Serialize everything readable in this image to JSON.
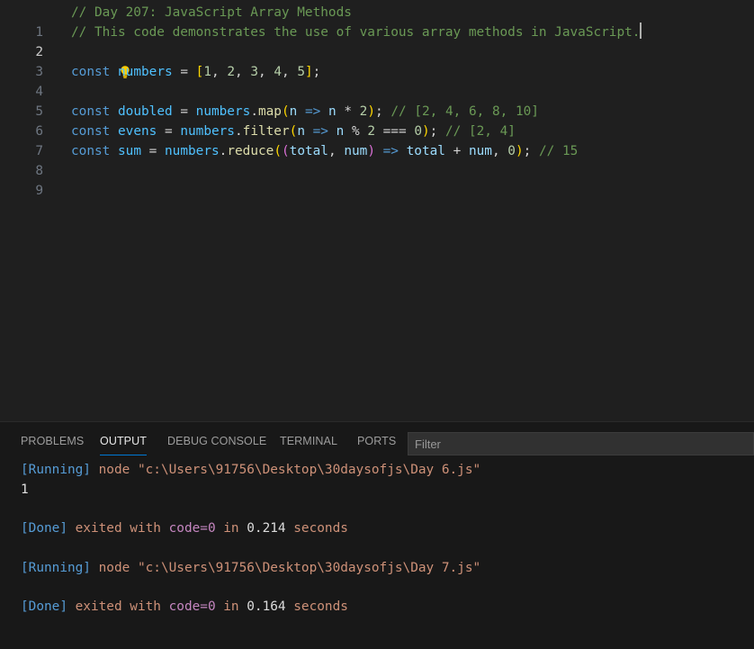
{
  "editor": {
    "line_numbers": [
      "1",
      "2",
      "3",
      "4",
      "5",
      "6",
      "7",
      "8",
      "9"
    ],
    "line1": {
      "comment": "// Day 207: JavaScript Array Methods"
    },
    "line2": {
      "comment": "// This code demonstrates the use of various array methods in JavaScript."
    },
    "line4": {
      "kw": "const",
      "name": "numbers",
      "eq": " = ",
      "open": "[",
      "n1": "1",
      "n2": "2",
      "n3": "3",
      "n4": "4",
      "n5": "5",
      "sep": ", ",
      "close": "]",
      "semi": ";"
    },
    "line6": {
      "kw": "const",
      "name": "doubled",
      "eq": " = ",
      "obj": "numbers",
      "dot": ".",
      "fn": "map",
      "open": "(",
      "param": "n",
      "arrow": " => ",
      "body_var": "n",
      "op": " * ",
      "num": "2",
      "close": ")",
      "semi": "; ",
      "comment": "// [2, 4, 6, 8, 10]"
    },
    "line7": {
      "kw": "const",
      "name": "evens",
      "eq": " = ",
      "obj": "numbers",
      "dot": ".",
      "fn": "filter",
      "open": "(",
      "param": "n",
      "arrow": " => ",
      "body_var": "n",
      "op1": " % ",
      "num1": "2",
      "op2": " === ",
      "num2": "0",
      "close": ")",
      "semi": "; ",
      "comment": "// [2, 4]"
    },
    "line8": {
      "kw": "const",
      "name": "sum",
      "eq": " = ",
      "obj": "numbers",
      "dot": ".",
      "fn": "reduce",
      "open": "(",
      "inner_open": "(",
      "p1": "total",
      "comma": ", ",
      "p2": "num",
      "inner_close": ")",
      "arrow": " => ",
      "b1": "total",
      "plus": " + ",
      "b2": "num",
      "comma2": ", ",
      "num": "0",
      "close": ")",
      "semi": "; ",
      "comment": "// 15"
    }
  },
  "panel": {
    "tabs": [
      "PROBLEMS",
      "OUTPUT",
      "DEBUG CONSOLE",
      "TERMINAL",
      "PORTS"
    ],
    "active_tab": "OUTPUT",
    "filter_placeholder": "Filter",
    "output": {
      "run1_tag": "[Running]",
      "run1_cmd": " node \"c:\\Users\\91756\\Desktop\\30daysofjs\\Day 6.js\"",
      "result1": "1",
      "done1_tag": "[Done]",
      "done1_a": " exited with ",
      "done1_code": "code=0",
      "done1_b": " in ",
      "done1_time": "0.214",
      "done1_c": " seconds",
      "run2_tag": "[Running]",
      "run2_cmd": " node \"c:\\Users\\91756\\Desktop\\30daysofjs\\Day 7.js\"",
      "done2_tag": "[Done]",
      "done2_a": " exited with ",
      "done2_code": "code=0",
      "done2_b": " in ",
      "done2_time": "0.164",
      "done2_c": " seconds"
    }
  },
  "icons": {
    "lightbulb": "lightbulb-icon"
  },
  "colors": {
    "accent": "#0078d4",
    "bulb": "#ffcc00"
  }
}
